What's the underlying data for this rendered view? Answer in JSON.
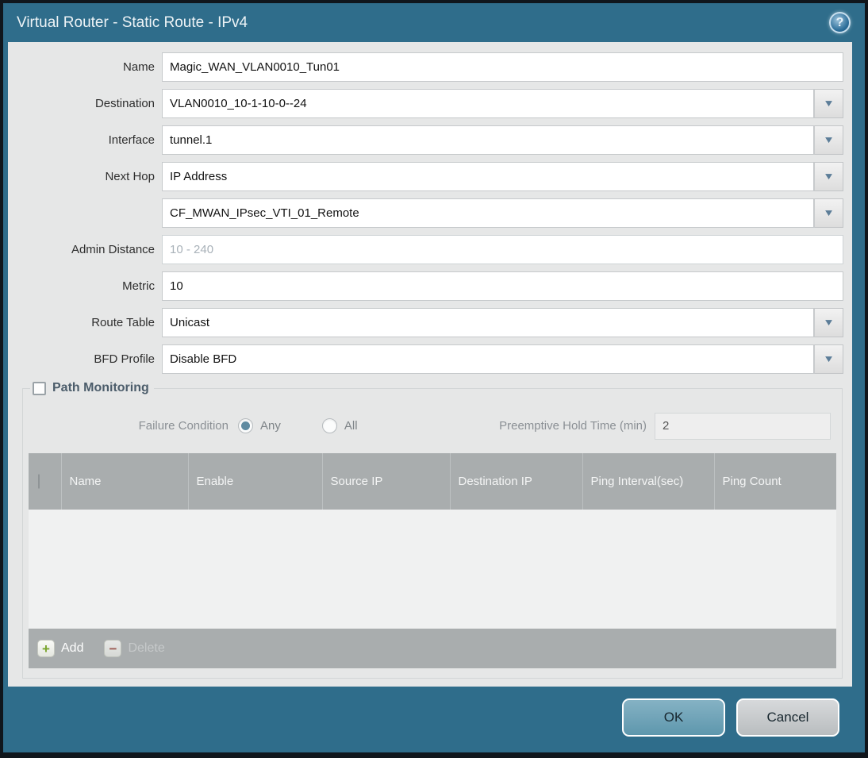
{
  "window": {
    "title": "Virtual Router - Static Route - IPv4",
    "help_glyph": "?"
  },
  "icons": {
    "dropdown_glyph": "▼",
    "add_glyph": "+",
    "delete_glyph": "−"
  },
  "form": {
    "name": {
      "label": "Name",
      "value": "Magic_WAN_VLAN0010_Tun01"
    },
    "destination": {
      "label": "Destination",
      "value": "VLAN0010_10-1-10-0--24"
    },
    "interface": {
      "label": "Interface",
      "value": "tunnel.1"
    },
    "next_hop": {
      "label": "Next Hop",
      "value": "IP Address"
    },
    "next_hop_address": {
      "value": "CF_MWAN_IPsec_VTI_01_Remote"
    },
    "admin_distance": {
      "label": "Admin Distance",
      "placeholder": "10 - 240"
    },
    "metric": {
      "label": "Metric",
      "value": "10"
    },
    "route_table": {
      "label": "Route Table",
      "value": "Unicast"
    },
    "bfd_profile": {
      "label": "BFD Profile",
      "value": "Disable BFD"
    }
  },
  "path_monitoring": {
    "legend": "Path Monitoring",
    "enabled": false,
    "failure_condition_label": "Failure Condition",
    "radio_any": "Any",
    "radio_all": "All",
    "selected_failure_condition": "Any",
    "preemptive_hold_time_label": "Preemptive Hold Time (min)",
    "preemptive_hold_time_value": "2",
    "table": {
      "columns": [
        "Name",
        "Enable",
        "Source IP",
        "Destination IP",
        "Ping Interval(sec)",
        "Ping Count"
      ],
      "rows": []
    },
    "toolbar": {
      "add_label": "Add",
      "delete_label": "Delete"
    }
  },
  "footer": {
    "ok_label": "OK",
    "cancel_label": "Cancel"
  },
  "colors": {
    "titlebar": "#2f6d8b",
    "outer_border": "#10161c",
    "panel_background": "#e6e7e7",
    "table_header": "#a9adae",
    "radio_selected": "#5f8ba1",
    "ok_button": "#6ba2b8",
    "add_icon_green": "#79a42c",
    "delete_icon_red": "#9c4f45",
    "dropdown_arrow": "#5c7d98"
  }
}
